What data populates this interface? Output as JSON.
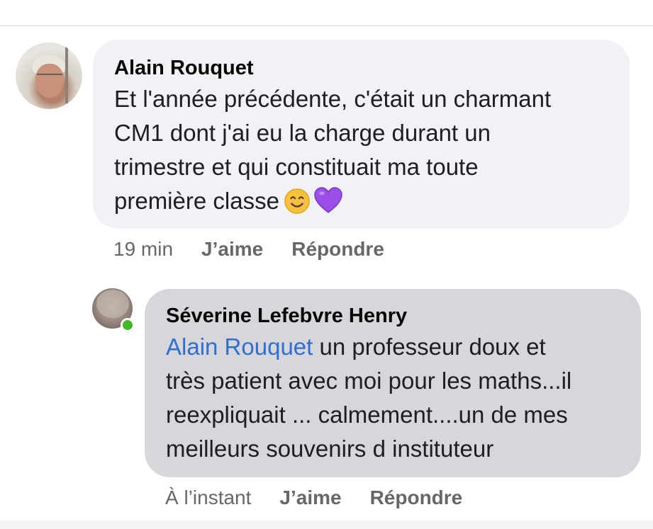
{
  "comment": {
    "author": "Alain Rouquet",
    "lines": [
      "Et l'année précédente, c'était un charmant",
      "CM1 dont j'ai eu la charge durant un",
      "trimestre et qui constituait ma toute",
      "première classe"
    ],
    "emojis": [
      "smiling-face-emoji",
      "purple-heart-emoji"
    ],
    "time": "19 min",
    "like_label": "J’aime",
    "reply_label": "Répondre"
  },
  "reply": {
    "author": "Séverine Lefebvre Henry",
    "mention": "Alain Rouquet",
    "lines": [
      " un professeur doux et",
      "très patient avec moi pour les maths...il",
      "reexpliquait ... calmement....un de mes",
      "meilleurs souvenirs d instituteur"
    ],
    "online": true,
    "time": "À l’instant",
    "like_label": "J’aime",
    "reply_label": "Répondre"
  },
  "colors": {
    "comment_bubble": "#f0f2f5",
    "reply_bubble": "#d7d7db",
    "mention_link": "#2e6fd1",
    "online_indicator": "#42b72a",
    "meta_text": "#65676b"
  }
}
